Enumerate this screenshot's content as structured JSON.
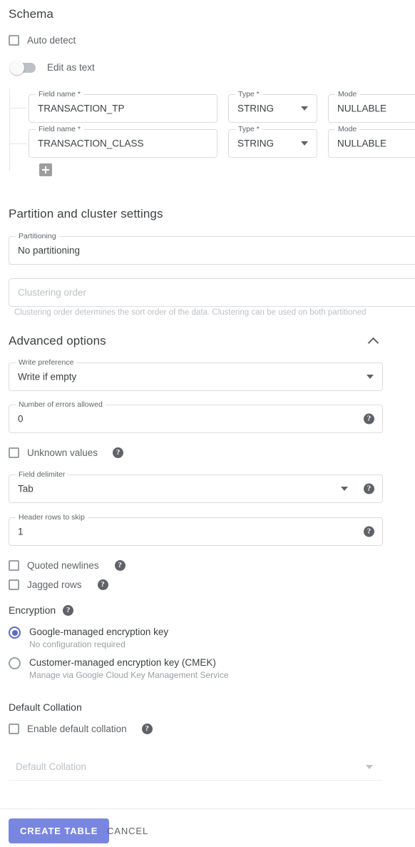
{
  "schema": {
    "title": "Schema",
    "auto_detect_label": "Auto detect",
    "auto_detect_checked": false,
    "edit_as_text_label": "Edit as text",
    "edit_as_text_on": false,
    "column_labels": {
      "field_name": "Field name *",
      "type": "Type *",
      "mode": "Mode"
    },
    "fields": [
      {
        "name": "TRANSACTION_TP",
        "type": "STRING",
        "mode": "NULLABLE"
      },
      {
        "name": "TRANSACTION_CLASS",
        "type": "STRING",
        "mode": "NULLABLE"
      }
    ],
    "add_field_icon": "plus-icon"
  },
  "partition": {
    "title": "Partition and cluster settings",
    "partitioning_label": "Partitioning",
    "partitioning_value": "No partitioning",
    "clustering_placeholder": "Clustering order",
    "clustering_hint": "Clustering order determines the sort order of the data. Clustering can be used on both partitioned"
  },
  "advanced": {
    "title": "Advanced options",
    "collapse_icon": "chevron-up-icon",
    "write_preference_label": "Write preference",
    "write_preference_value": "Write if empty",
    "errors_allowed_label": "Number of errors allowed",
    "errors_allowed_value": "0",
    "unknown_values_label": "Unknown values",
    "unknown_values_checked": false,
    "field_delimiter_label": "Field delimiter",
    "field_delimiter_value": "Tab",
    "header_rows_label": "Header rows to skip",
    "header_rows_value": "1",
    "quoted_newlines_label": "Quoted newlines",
    "quoted_newlines_checked": false,
    "jagged_rows_label": "Jagged rows",
    "jagged_rows_checked": false,
    "help_icon": "help-icon"
  },
  "encryption": {
    "title": "Encryption",
    "options": [
      {
        "label": "Google-managed encryption key",
        "sublabel": "No configuration required",
        "selected": true
      },
      {
        "label": "Customer-managed encryption key (CMEK)",
        "sublabel": "Manage via Google Cloud Key Management Service",
        "selected": false
      }
    ]
  },
  "collation": {
    "title": "Default Collation",
    "enable_label": "Enable default collation",
    "enable_checked": false,
    "select_placeholder": "Default Collation"
  },
  "footer": {
    "create_label": "CREATE TABLE",
    "cancel_label": "CANCEL"
  },
  "colors": {
    "primary": "#7986e0",
    "radio_selected": "#5c6bc0",
    "border": "#dadce0",
    "text": "#3c4043",
    "muted": "#5f6368",
    "placeholder": "#bdc1c6"
  }
}
